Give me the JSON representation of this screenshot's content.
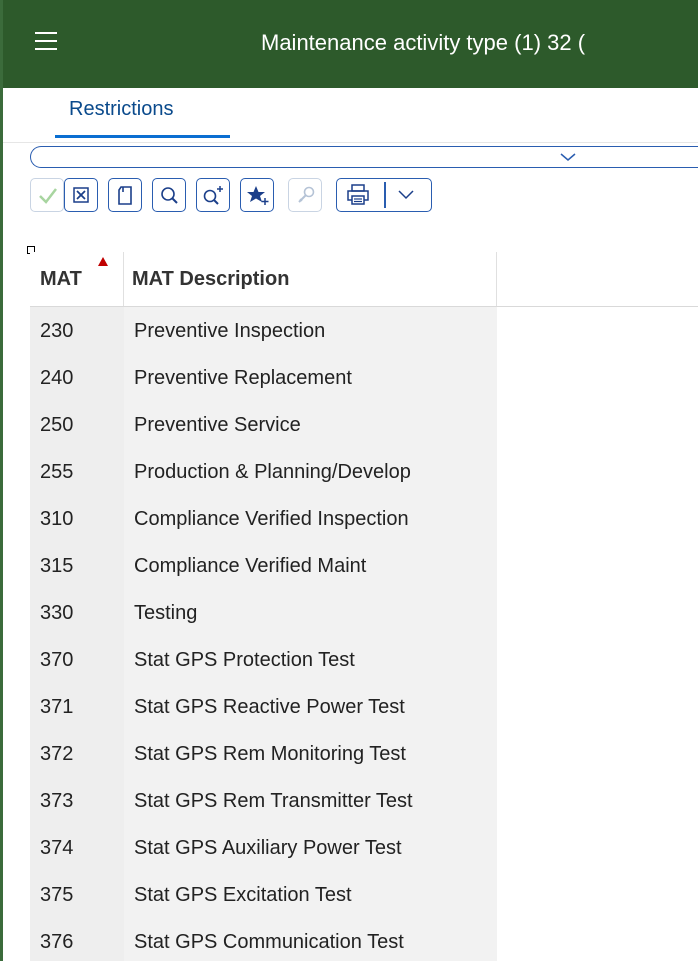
{
  "header": {
    "title": "Maintenance activity type (1)  32 (",
    "bg_color": "#2d5a2b"
  },
  "tabs": [
    {
      "label": "Restrictions",
      "active": true
    }
  ],
  "toolbar": {
    "icons": [
      "check-icon",
      "cancel-icon",
      "copy-icon",
      "search-icon",
      "search-next-icon",
      "favorite-add-icon",
      "help-icon",
      "print-icon",
      "chevron-down-icon"
    ]
  },
  "table": {
    "columns": [
      "MAT",
      "MAT Description"
    ],
    "sorted_column": "MAT",
    "rows": [
      {
        "mat": "230",
        "desc": "Preventive Inspection"
      },
      {
        "mat": "240",
        "desc": "Preventive Replacement"
      },
      {
        "mat": "250",
        "desc": "Preventive Service"
      },
      {
        "mat": "255",
        "desc": "Production & Planning/Develop"
      },
      {
        "mat": "310",
        "desc": "Compliance Verified Inspection"
      },
      {
        "mat": "315",
        "desc": "Compliance Verified Maint"
      },
      {
        "mat": "330",
        "desc": "Testing"
      },
      {
        "mat": "370",
        "desc": "Stat GPS Protection Test"
      },
      {
        "mat": "371",
        "desc": "Stat GPS Reactive Power Test"
      },
      {
        "mat": "372",
        "desc": "Stat GPS Rem Monitoring Test"
      },
      {
        "mat": "373",
        "desc": "Stat GPS Rem Transmitter Test"
      },
      {
        "mat": "374",
        "desc": "Stat GPS Auxiliary Power Test"
      },
      {
        "mat": "375",
        "desc": "Stat GPS Excitation Test"
      },
      {
        "mat": "376",
        "desc": "Stat GPS Communication Test"
      }
    ]
  },
  "colors": {
    "accent": "#0a6ed1",
    "sort_indicator": "#c00000"
  }
}
